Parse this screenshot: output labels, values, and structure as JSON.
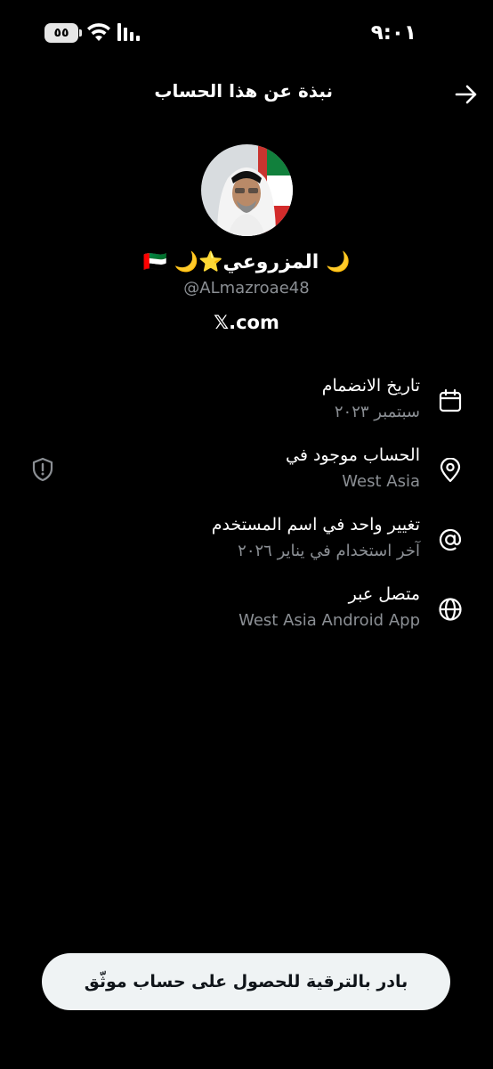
{
  "status_bar": {
    "time": "٩:٠١",
    "battery": "٥٥"
  },
  "header": {
    "title": "نبذة عن هذا الحساب",
    "back_icon": "arrow-right-icon"
  },
  "profile": {
    "display_name": "🌙 المزروعي⭐🌙 🇦🇪",
    "handle": "@ALmazroae48",
    "website": "𝕏.com"
  },
  "rows": [
    {
      "icon": "calendar-icon",
      "title": "تاريخ الانضمام",
      "value": "سبتمبر ٢٠٢٣"
    },
    {
      "icon": "location-pin-icon",
      "title": "الحساب موجود في",
      "value": "West Asia"
    },
    {
      "icon": "at-sign-icon",
      "title": "تغيير واحد في اسم المستخدم",
      "value": "آخر استخدام في يناير ٢٠٢٦"
    },
    {
      "icon": "globe-icon",
      "title": "متصل عبر",
      "value": "West Asia Android App"
    }
  ],
  "upgrade_button": {
    "label": "بادر بالترقية للحصول على حساب موثّق"
  },
  "colors": {
    "background": "#000000",
    "secondary_text": "#8b8f94",
    "button_bg": "#eff3f4"
  }
}
